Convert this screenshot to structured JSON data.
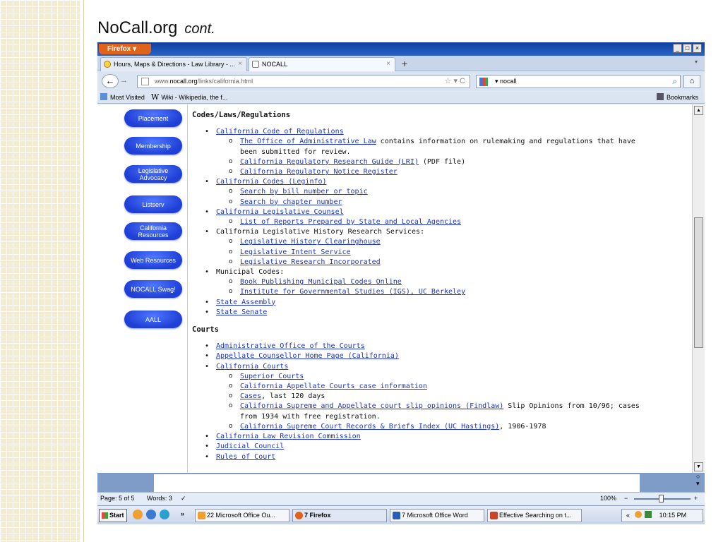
{
  "slide": {
    "title": "NoCall.org",
    "subtitle": "cont."
  },
  "browser": {
    "app_button": "Firefox ▾",
    "window_controls": [
      "_",
      "□",
      "×"
    ],
    "tabs": [
      {
        "label": "Hours, Maps & Directions - Law Library - ...",
        "close": "×"
      },
      {
        "label": "NOCALL",
        "close": "×"
      }
    ],
    "new_tab": "+",
    "tab_list_arrow": "▾",
    "back": "←",
    "forward": "→",
    "url": {
      "prefix": "www.",
      "domain": "nocall.org",
      "path": "/links/california.html",
      "tools": "☆ ▾  C"
    },
    "search": {
      "engine_arrow": "▾",
      "value": "nocall",
      "button": "⌕"
    },
    "home": "⌂",
    "bookmarks": {
      "most_visited": "Most Visited",
      "wiki_glyph": "W",
      "wiki": "Wiki - Wikipedia, the f...",
      "bookmarks_menu": "Bookmarks"
    }
  },
  "nav_buttons": [
    "Placement",
    "Membership",
    "Legislative Advocacy",
    "Listserv",
    "California Resources",
    "Web Resources",
    "NOCALL Swag!",
    "AALL"
  ],
  "sections": {
    "codes_title": "Codes/Laws/Regulations",
    "courts_title": "Courts"
  },
  "codes": {
    "ccr": "California Code of Regulations",
    "oal_link": "The Office of Administrative Law",
    "oal_text": " contains information on rulemaking and regulations that have been submitted for review.",
    "lri_link": "California Regulatory Research Guide (LRI)",
    "lri_text": " (PDF file)",
    "notice": "California Regulatory Notice Register",
    "leginfo": "California Codes (Leginfo)",
    "bill": "Search by bill number or topic",
    "chapter": "Search by chapter number",
    "counsel": "California Legislative Counsel",
    "reports": "List of Reports Prepared by State and Local Agencies",
    "history_text": "California Legislative History Research Services:",
    "clearinghouse": "Legislative History Clearinghouse",
    "intent": "Legislative Intent Service",
    "research_inc": "Legislative Research Incorporated",
    "municipal_text": "Municipal Codes:",
    "bpmc": "Book Publishing Municipal Codes Online",
    "igs": "Institute for Governmental Studies (IGS), UC Berkeley",
    "assembly": "State Assembly",
    "senate": "State Senate"
  },
  "courts": {
    "aoc": "Administrative Office of the Courts",
    "appellate_counsellor": "Appellate Counsellor Home Page (California)",
    "ca_courts": "California Courts",
    "superior": "Superior Courts",
    "appellate_info": "California Appellate Courts case information",
    "cases_link": "Cases",
    "cases_text": ", last 120 days",
    "findlaw_link": "California Supreme and Appellate court slip opinions (Findlaw)",
    "findlaw_text": " Slip Opinions from 10/96; cases from 1934 with free registration.",
    "hastings_link": "California Supreme Court Records & Briefs Index (UC Hastings)",
    "hastings_text": ", 1906-1978",
    "revision": "California Law Revision Commission",
    "judicial": "Judicial Council",
    "rules": "Rules of Court"
  },
  "word_status": {
    "page": "Page: 5 of 5",
    "words": "Words: 3",
    "check": "✓",
    "zoom": "100%",
    "zoom_minus": "−",
    "zoom_plus": "+",
    "zoom_level_percent": 100
  },
  "taskbar": {
    "start": "Start",
    "chevron": "»",
    "items": [
      "22 Microsoft Office Ou...",
      "7 Firefox",
      "7 Microsoft Office Word",
      "Effective Searching on t..."
    ],
    "clock": "10:15 PM",
    "tray_chevron": "«"
  }
}
